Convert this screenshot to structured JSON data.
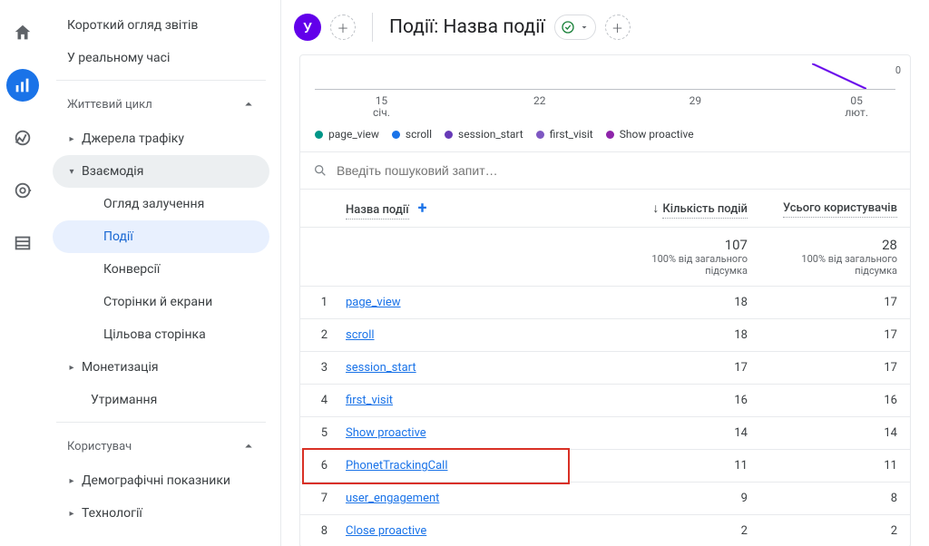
{
  "rail": {
    "items": [
      "home",
      "reports",
      "explore",
      "advertising",
      "config"
    ],
    "active_index": 1
  },
  "sidebar": {
    "top_links": [
      {
        "label": "Короткий огляд звітів"
      },
      {
        "label": "У реальному часі"
      }
    ],
    "groups": [
      {
        "label": "Життєвий цикл",
        "items": [
          {
            "label": "Джерела трафіку",
            "expandable": true,
            "level": 1
          },
          {
            "label": "Взаємодія",
            "expandable": true,
            "level": 1,
            "open": true,
            "highlight": true
          },
          {
            "label": "Огляд залучення",
            "level": 2
          },
          {
            "label": "Події",
            "level": 2,
            "active": true
          },
          {
            "label": "Конверсії",
            "level": 2
          },
          {
            "label": "Сторінки й екрани",
            "level": 2
          },
          {
            "label": "Цільова сторінка",
            "level": 2
          },
          {
            "label": "Монетизація",
            "expandable": true,
            "level": 1
          },
          {
            "label": "Утримання",
            "level": 1
          }
        ]
      },
      {
        "label": "Користувач",
        "items": [
          {
            "label": "Демографічні показники",
            "expandable": true,
            "level": 1
          },
          {
            "label": "Технології",
            "expandable": true,
            "level": 1
          }
        ]
      }
    ]
  },
  "header": {
    "chip_letter": "У",
    "title": "Події: Назва події"
  },
  "chart_data": {
    "type": "line",
    "x_ticks": [
      {
        "top": "15",
        "bottom": "січ."
      },
      {
        "top": "22",
        "bottom": ""
      },
      {
        "top": "29",
        "bottom": ""
      },
      {
        "top": "05",
        "bottom": "лют."
      }
    ],
    "y_zero_label": "0",
    "series": [
      {
        "name": "page_view",
        "color": "#009688"
      },
      {
        "name": "scroll",
        "color": "#1a73e8"
      },
      {
        "name": "session_start",
        "color": "#673ab7"
      },
      {
        "name": "first_visit",
        "color": "#7e57c2"
      },
      {
        "name": "Show proactive",
        "color": "#8e24aa"
      }
    ]
  },
  "search": {
    "placeholder": "Введіть пошуковий запит…"
  },
  "table": {
    "columns": [
      {
        "label": "Назва події",
        "key": "name"
      },
      {
        "label": "Кількість подій",
        "key": "events",
        "sorted": true
      },
      {
        "label": "Усього користувачів",
        "key": "users"
      }
    ],
    "totals": {
      "events": "107",
      "events_sub": "100% від загального підсумка",
      "users": "28",
      "users_sub": "100% від загального підсумка"
    },
    "rows": [
      {
        "name": "page_view",
        "events": "18",
        "users": "17"
      },
      {
        "name": "scroll",
        "events": "18",
        "users": "17"
      },
      {
        "name": "session_start",
        "events": "17",
        "users": "17"
      },
      {
        "name": "first_visit",
        "events": "16",
        "users": "16"
      },
      {
        "name": "Show proactive",
        "events": "14",
        "users": "14"
      },
      {
        "name": "PhonetTrackingCall",
        "events": "11",
        "users": "11",
        "highlight": true
      },
      {
        "name": "user_engagement",
        "events": "9",
        "users": "8"
      },
      {
        "name": "Close proactive",
        "events": "2",
        "users": "2"
      }
    ]
  }
}
